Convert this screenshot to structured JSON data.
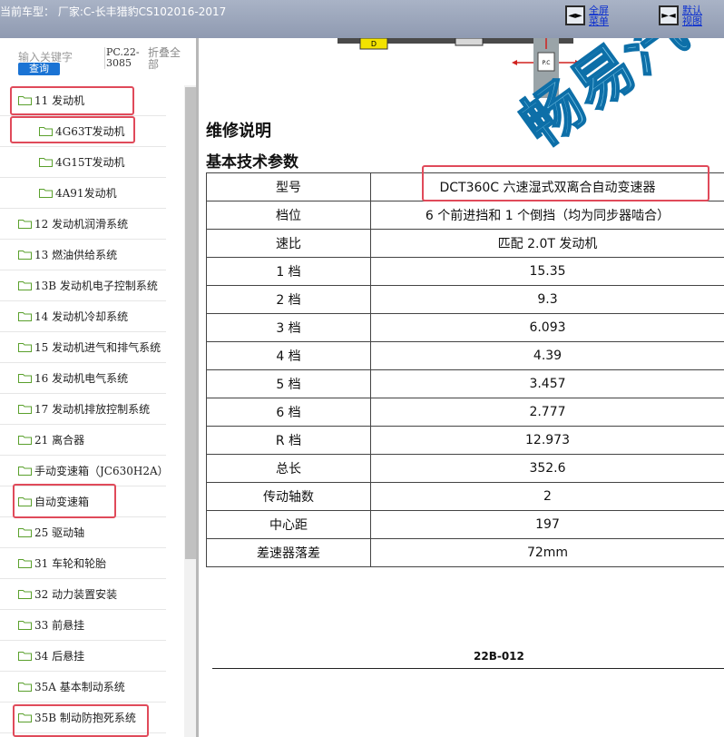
{
  "header": {
    "title": "当前车型： 厂家:C-长丰猎豹CS102016-2017",
    "fullscreen_menu": [
      "全屏",
      "菜单"
    ],
    "default_view": [
      "默认",
      "视图"
    ]
  },
  "sidebar": {
    "search_placeholder": "输入关键字",
    "search_button": "查询",
    "pc_label": "PC.22-3085",
    "collapse_all": "折叠全部",
    "items": [
      {
        "label": "11 发动机"
      },
      {
        "label": "4G63T发动机"
      },
      {
        "label": "4G15T发动机"
      },
      {
        "label": "4A91发动机"
      },
      {
        "label": "12 发动机润滑系统"
      },
      {
        "label": "13 燃油供给系统"
      },
      {
        "label": "13B 发动机电子控制系统"
      },
      {
        "label": "14 发动机冷却系统"
      },
      {
        "label": "15 发动机进气和排气系统"
      },
      {
        "label": "16 发动机电气系统"
      },
      {
        "label": "17 发动机排放控制系统"
      },
      {
        "label": "21 离合器"
      },
      {
        "label": "手动变速箱（JC630H2A）"
      },
      {
        "label": "自动变速箱"
      },
      {
        "label": "25 驱动轴"
      },
      {
        "label": "31 车轮和轮胎"
      },
      {
        "label": "32 动力装置安装"
      },
      {
        "label": "33 前悬挂"
      },
      {
        "label": "34 后悬挂"
      },
      {
        "label": "35A 基本制动系统"
      },
      {
        "label": "35B 制动防抱死系统"
      }
    ]
  },
  "content": {
    "diagram_labels": {
      "d": "D",
      "pc": "P.C"
    },
    "heading": "维修说明",
    "subheading": "基本技术参数",
    "table": [
      [
        "型号",
        "DCT360C 六速湿式双离合自动变速器"
      ],
      [
        "档位",
        "6 个前进挡和 1 个倒挡（均为同步器啮合）"
      ],
      [
        "速比",
        "匹配 2.0T 发动机"
      ],
      [
        "1 档",
        "15.35"
      ],
      [
        "2 档",
        "9.3"
      ],
      [
        "3 档",
        "6.093"
      ],
      [
        "4 档",
        "4.39"
      ],
      [
        "5 档",
        "3.457"
      ],
      [
        "6 档",
        "2.777"
      ],
      [
        "R 档",
        "12.973"
      ],
      [
        "总长",
        "352.6"
      ],
      [
        "传动轴数",
        "2"
      ],
      [
        "中心距",
        "197"
      ],
      [
        "差速器落差",
        "72mm"
      ]
    ],
    "watermark": "畅易汽车维修平台",
    "page_number": "22B-012"
  },
  "colors": {
    "highlight": "#e04a5a",
    "folder": "#5aa02c",
    "search_button": "#1a73d4",
    "watermark": "#0d6fa8"
  }
}
